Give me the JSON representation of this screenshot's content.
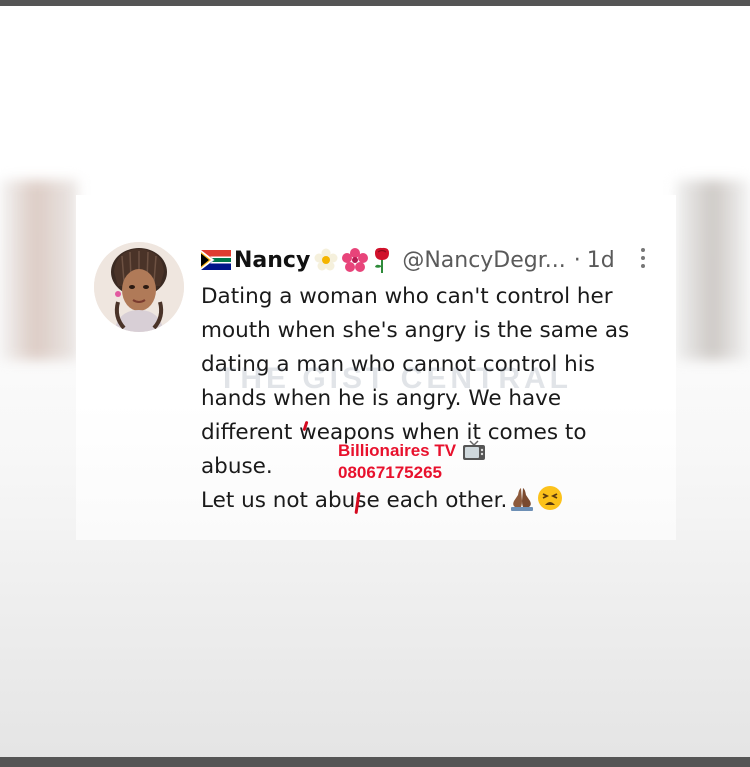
{
  "post": {
    "display_name": "Nancy",
    "handle": "@NancyDegr...",
    "separator": "·",
    "time": "1d",
    "text_lines": [
      "Dating a woman who can't control her",
      "mouth when she's angry is the same as",
      "dating a man who cannot control his",
      "hands when he is angry. We have",
      "different weapons when it comes to",
      "abuse.",
      "Let us not abuse each other."
    ]
  },
  "icons": {
    "flag": "south-africa-flag-icon",
    "name_emojis": [
      "blossom-icon",
      "hibiscus-icon",
      "rose-icon"
    ],
    "end_emojis": [
      "folded-hands-icon",
      "tired-face-icon"
    ],
    "more": "more-vertical-icon",
    "tv": "television-icon"
  },
  "watermark": {
    "text": "THE GIST CENTRAL"
  },
  "overlay": {
    "line1": "Billionaires TV",
    "line2": "08067175265",
    "color": "#e8112d"
  },
  "colors": {
    "frame_bar": "#555555",
    "text": "#1a1a1a",
    "muted": "#5a5a5a"
  }
}
